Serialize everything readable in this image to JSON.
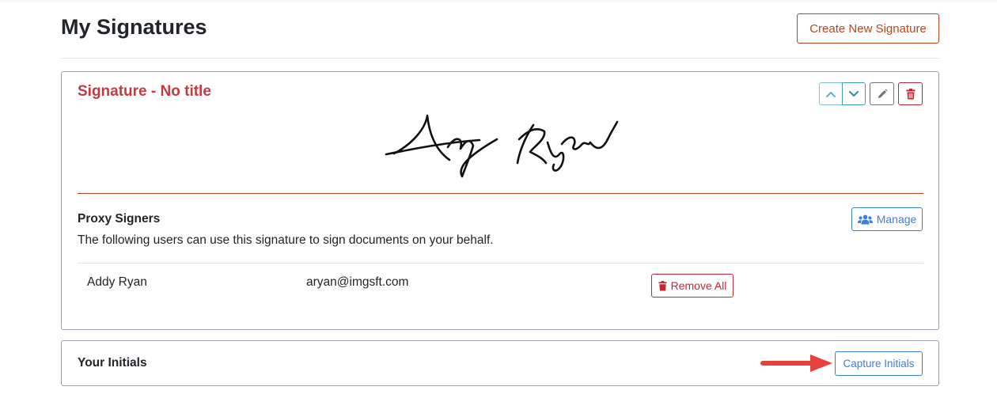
{
  "header": {
    "title": "My Signatures",
    "create_button": "Create New Signature"
  },
  "signature_card": {
    "title": "Signature - No title",
    "move_up_icon": "chevron-up-icon",
    "move_down_icon": "chevron-down-icon",
    "edit_icon": "pencil-icon",
    "delete_icon": "trash-icon",
    "signature_image": "handwritten-signature"
  },
  "proxy_signers": {
    "heading": "Proxy Signers",
    "description": "The following users can use this signature to sign documents on your behalf.",
    "manage_button": "Manage",
    "manage_icon": "users-icon",
    "rows": [
      {
        "name": "Addy Ryan",
        "email": "aryan@imgsft.com"
      }
    ],
    "remove_all_button": "Remove All",
    "remove_icon": "trash-icon"
  },
  "initials": {
    "heading": "Your Initials",
    "capture_button": "Capture Initials",
    "annotation": "red-arrow-pointer"
  },
  "colors": {
    "accent": "#b5461f",
    "danger": "#c82333",
    "primary": "#3c7fd6",
    "info": "#2e8ea5",
    "title_red": "#c9373e"
  }
}
